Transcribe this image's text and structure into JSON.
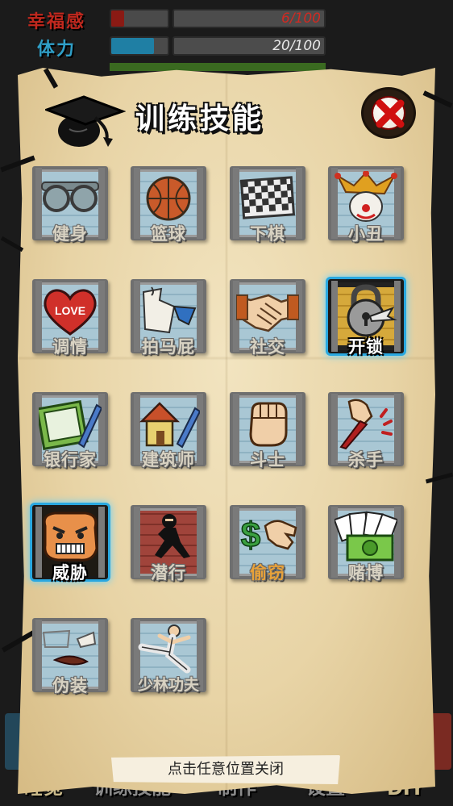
{
  "status": {
    "happiness": {
      "label": "幸福感",
      "value_text": "6/100",
      "fraction": 0.06
    },
    "stamina": {
      "label": "体力",
      "value_text": "20/100",
      "fraction": 0.2
    }
  },
  "background_nav": {
    "sleep": "睡觉",
    "train": "训练技能",
    "work": "制作",
    "custom": "设置",
    "diy": "DIY"
  },
  "dialog": {
    "title": "训练技能",
    "close_hint": "点击任意位置关闭"
  },
  "skills": [
    {
      "label": "健身",
      "icon": "goggles-icon"
    },
    {
      "label": "篮球",
      "icon": "basketball-icon"
    },
    {
      "label": "下棋",
      "icon": "chessboard-icon"
    },
    {
      "label": "小丑",
      "icon": "jester-icon"
    },
    {
      "label": "调情",
      "icon": "love-heart-icon"
    },
    {
      "label": "拍马屁",
      "icon": "flattery-icon"
    },
    {
      "label": "社交",
      "icon": "handshake-icon"
    },
    {
      "label": "开锁",
      "icon": "padlock-icon"
    },
    {
      "label": "银行家",
      "icon": "banker-notebook-icon"
    },
    {
      "label": "建筑师",
      "icon": "architect-house-icon"
    },
    {
      "label": "斗士",
      "icon": "fist-icon"
    },
    {
      "label": "杀手",
      "icon": "knife-hand-icon"
    },
    {
      "label": "威胁",
      "icon": "angry-face-icon"
    },
    {
      "label": "潜行",
      "icon": "ninja-icon"
    },
    {
      "label": "偷窃",
      "icon": "stealing-hand-icon"
    },
    {
      "label": "赌博",
      "icon": "cards-cash-icon"
    },
    {
      "label": "伪装",
      "icon": "disguise-icon"
    },
    {
      "label": "少林功夫",
      "icon": "kungfu-kick-icon"
    }
  ],
  "colors": {
    "parchment": "#e8d4a6",
    "highlight": "#2aa8e0",
    "happiness_label": "#c0281e",
    "stamina_label": "#2f9fc8",
    "close_x": "#d01010"
  }
}
